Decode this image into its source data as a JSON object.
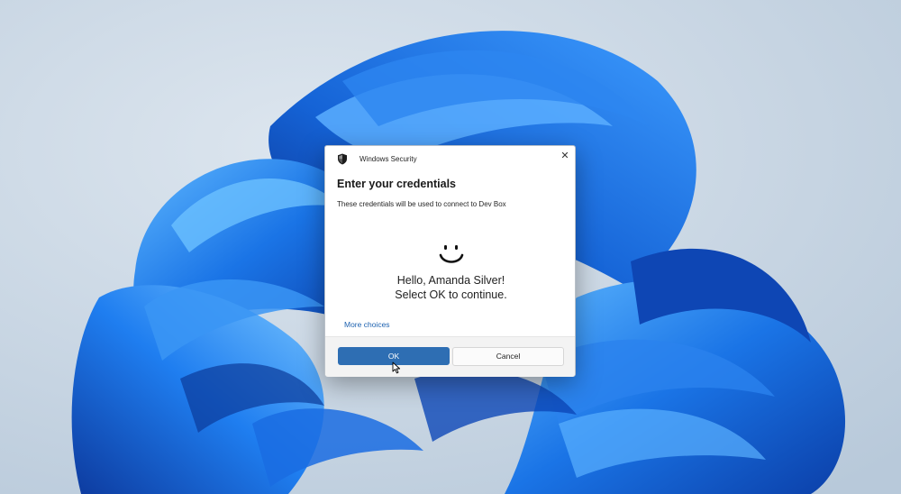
{
  "dialog": {
    "app_title": "Windows Security",
    "close_glyph": "✕",
    "heading": "Enter your credentials",
    "subtext": "These credentials will be used to connect to Dev Box",
    "greeting_line1": "Hello, Amanda Silver!",
    "greeting_line2": "Select OK to continue.",
    "more_choices": "More choices",
    "ok_label": "OK",
    "cancel_label": "Cancel"
  },
  "icons": {
    "titlebar": "shield-icon",
    "greeting": "smiley-icon",
    "pointer": "cursor-icon"
  },
  "colors": {
    "accent": "#2e6eb3",
    "link": "#1e62b0",
    "desktop_background": "#c7d6e6",
    "wallpaper_bloom": "#1a6fe0"
  }
}
